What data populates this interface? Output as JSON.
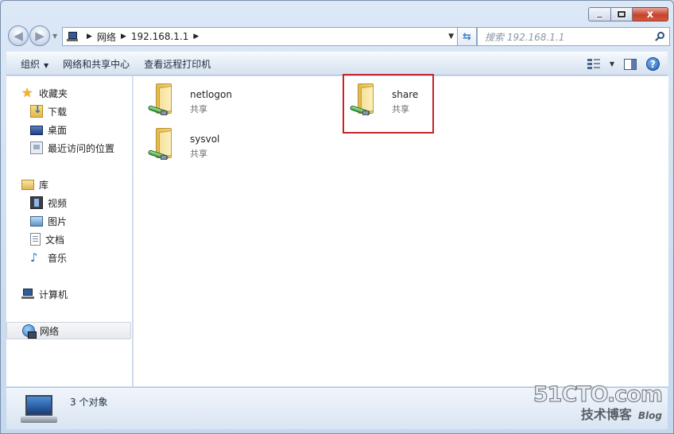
{
  "window": {
    "caption": {
      "minimize": "",
      "maximize": "",
      "close": "x"
    }
  },
  "nav": {
    "breadcrumbs": [
      "网络",
      "192.168.1.1"
    ],
    "search_placeholder": "搜索 192.168.1.1"
  },
  "toolbar": {
    "organize": "组织",
    "network_center": "网络和共享中心",
    "view_printers": "查看远程打印机",
    "help": "?"
  },
  "sidebar": {
    "favorites": {
      "label": "收藏夹",
      "items": [
        {
          "label": "下载"
        },
        {
          "label": "桌面"
        },
        {
          "label": "最近访问的位置"
        }
      ]
    },
    "libraries": {
      "label": "库",
      "items": [
        {
          "label": "视频"
        },
        {
          "label": "图片"
        },
        {
          "label": "文档"
        },
        {
          "label": "音乐"
        }
      ]
    },
    "computer": {
      "label": "计算机"
    },
    "network": {
      "label": "网络"
    }
  },
  "content": {
    "items": [
      {
        "name": "netlogon",
        "type": "共享"
      },
      {
        "name": "share",
        "type": "共享"
      },
      {
        "name": "sysvol",
        "type": "共享"
      }
    ]
  },
  "details": {
    "count_text": "3 个对象"
  },
  "watermark": {
    "main": "51CTO.com",
    "sub": "技术博客",
    "blog": "Blog"
  },
  "colors": {
    "highlight": "#c5232a",
    "accent": "#1d5fb8"
  }
}
